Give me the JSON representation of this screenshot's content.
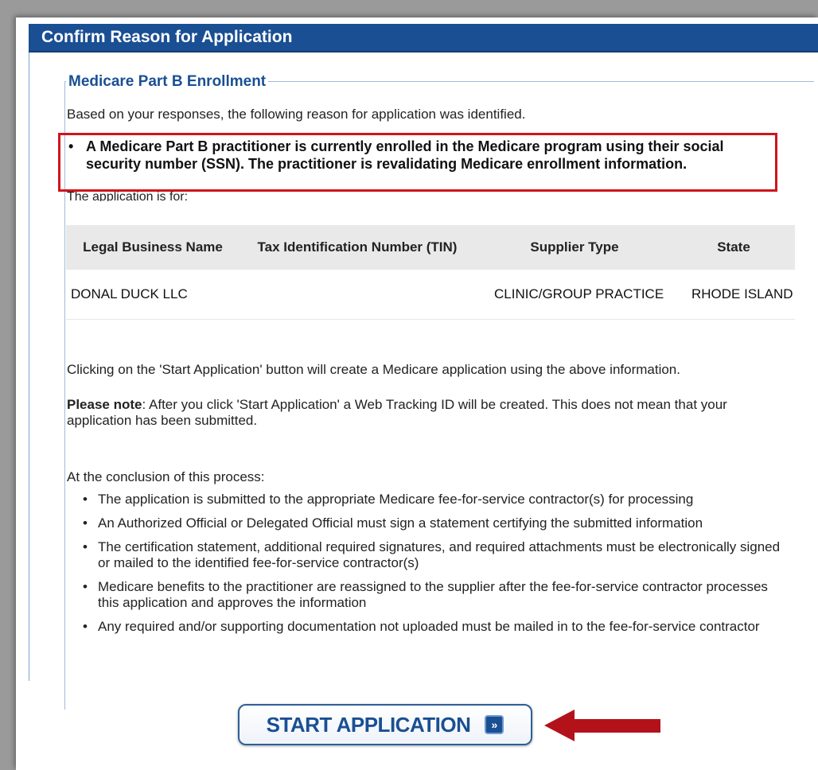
{
  "header": {
    "title": "Confirm Reason for Application"
  },
  "section": {
    "title": "Medicare Part B Enrollment",
    "intro": "Based on your responses, the following reason for application was identified.",
    "reason": "A Medicare Part B practitioner is currently enrolled in the Medicare program using their social security number (SSN). The practitioner is revalidating Medicare enrollment information.",
    "application_for_label": "The application is for:"
  },
  "table": {
    "headers": [
      "Legal Business Name",
      "Tax Identification Number (TIN)",
      "Supplier Type",
      "State"
    ],
    "rows": [
      {
        "legal_business_name": "DONAL DUCK LLC",
        "tin": "",
        "supplier_type": "CLINIC/GROUP PRACTICE",
        "state": "RHODE ISLAND"
      }
    ]
  },
  "notes": {
    "start_info": "Clicking on the 'Start Application' button will create a Medicare application using the above information.",
    "please_note_label": "Please note",
    "please_note_text": ": After you click 'Start Application' a Web Tracking ID will be created. This does not mean that your application has been submitted."
  },
  "conclusion": {
    "heading": "At the conclusion of this process:",
    "items": [
      "The application is submitted to the appropriate Medicare fee-for-service contractor(s) for processing",
      "An Authorized Official or Delegated Official must sign a statement certifying the submitted information",
      "The certification statement, additional required signatures, and required attachments must be electronically signed or mailed to the identified fee-for-service contractor(s)",
      "Medicare benefits to the practitioner are reassigned to the supplier after the fee-for-service contractor processes this application and approves the information",
      "Any required and/or supporting documentation not uploaded must be mailed in to the fee-for-service contractor"
    ]
  },
  "actions": {
    "start_label": "START APPLICATION",
    "start_icon": "double-chevron-right-icon"
  },
  "colors": {
    "header_blue": "#1a4f93",
    "highlight_red": "#d0141c",
    "arrow_red": "#b3121a"
  }
}
